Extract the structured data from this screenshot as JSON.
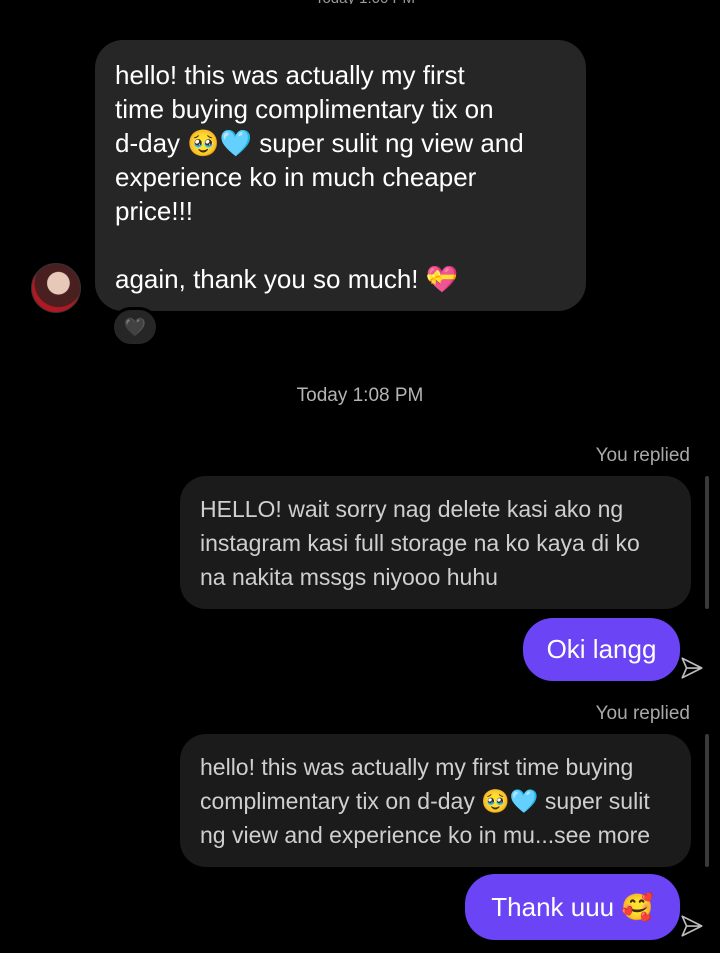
{
  "incoming": {
    "lines": [
      "hello! this was actually my first",
      "time buying complimentary tix on",
      "d-day 🥹🩵 super sulit ng view and",
      "experience ko in much cheaper",
      "price!!!"
    ],
    "closing": "again, thank you so much! 💝",
    "reaction": "🖤"
  },
  "timestamp": "Today 1:08 PM",
  "outgoing": [
    {
      "replied_label": "You replied",
      "quote": "HELLO! wait sorry nag delete kasi ako ng instagram kasi full storage na ko kaya di ko na nakita mssgs niyooo huhu",
      "message": "Oki langg"
    },
    {
      "replied_label": "You replied",
      "quote": "hello! this was actually my first time buying complimentary tix on d-day 🥹🩵 super sulit ng view and experience ko in mu...see more",
      "message": "Thank uuu 🥰"
    }
  ],
  "colors": {
    "background": "#000000",
    "incoming_bubble": "#262626",
    "outgoing_bubble": "#6a44f5",
    "quote_bubble": "#1b1b1b"
  }
}
